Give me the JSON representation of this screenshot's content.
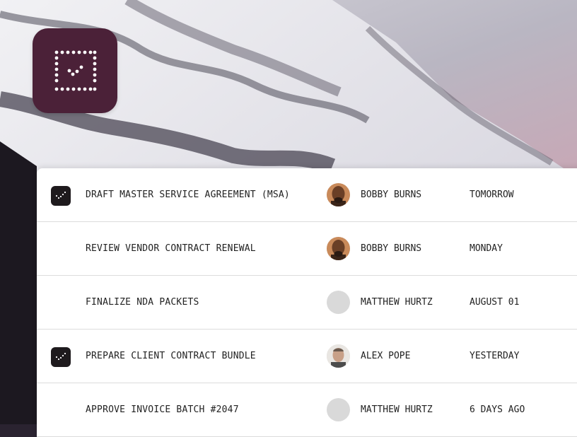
{
  "app": {
    "icon": "dotted-checkbox-icon",
    "icon_color": "#4b2138"
  },
  "tasks": [
    {
      "checked": true,
      "title": "DRAFT MASTER SERVICE AGREEMENT (MSA)",
      "assignee": "BOBBY BURNS",
      "avatar": "photo-dark",
      "due": "TOMORROW"
    },
    {
      "checked": false,
      "title": "REVIEW VENDOR CONTRACT RENEWAL",
      "assignee": "BOBBY BURNS",
      "avatar": "photo-dark",
      "due": "MONDAY"
    },
    {
      "checked": false,
      "title": "FINALIZE NDA PACKETS",
      "assignee": "MATTHEW HURTZ",
      "avatar": "placeholder",
      "due": "AUGUST 01"
    },
    {
      "checked": true,
      "title": "PREPARE CLIENT CONTRACT BUNDLE",
      "assignee": "ALEX POPE",
      "avatar": "photo-light",
      "due": "YESTERDAY"
    },
    {
      "checked": false,
      "title": "APPROVE INVOICE BATCH #2047",
      "assignee": "MATTHEW HURTZ",
      "avatar": "placeholder",
      "due": "6 DAYS AGO"
    }
  ]
}
